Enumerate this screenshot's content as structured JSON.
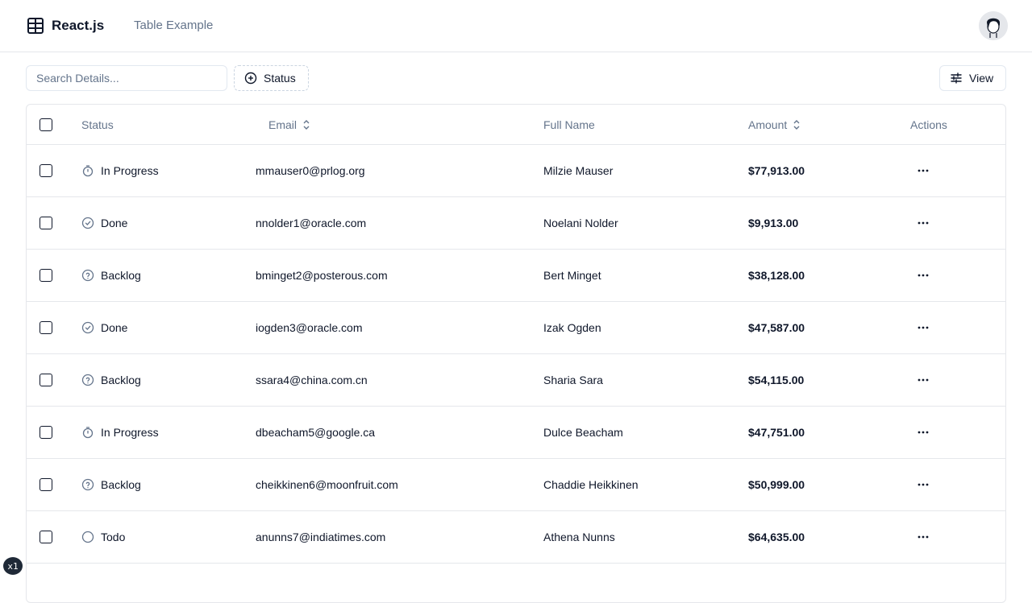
{
  "header": {
    "brand": "React.js",
    "brand_icon": "table-icon",
    "nav_link": "Table Example",
    "avatar_icon": "user-avatar"
  },
  "toolbar": {
    "search_placeholder": "Search Details...",
    "status_filter_label": "Status",
    "view_label": "View"
  },
  "table": {
    "columns": {
      "status": "Status",
      "email": "Email",
      "full_name": "Full Name",
      "amount": "Amount",
      "actions": "Actions"
    },
    "rows": [
      {
        "status": "In Progress",
        "status_icon": "timer-icon",
        "email": "mmauser0@prlog.org",
        "full_name": "Milzie Mauser",
        "amount": "$77,913.00"
      },
      {
        "status": "Done",
        "status_icon": "check-circle-icon",
        "email": "nnolder1@oracle.com",
        "full_name": "Noelani Nolder",
        "amount": "$9,913.00"
      },
      {
        "status": "Backlog",
        "status_icon": "help-circle-icon",
        "email": "bminget2@posterous.com",
        "full_name": "Bert Minget",
        "amount": "$38,128.00"
      },
      {
        "status": "Done",
        "status_icon": "check-circle-icon",
        "email": "iogden3@oracle.com",
        "full_name": "Izak Ogden",
        "amount": "$47,587.00"
      },
      {
        "status": "Backlog",
        "status_icon": "help-circle-icon",
        "email": "ssara4@china.com.cn",
        "full_name": "Sharia Sara",
        "amount": "$54,115.00"
      },
      {
        "status": "In Progress",
        "status_icon": "timer-icon",
        "email": "dbeacham5@google.ca",
        "full_name": "Dulce Beacham",
        "amount": "$47,751.00"
      },
      {
        "status": "Backlog",
        "status_icon": "help-circle-icon",
        "email": "cheikkinen6@moonfruit.com",
        "full_name": "Chaddie Heikkinen",
        "amount": "$50,999.00"
      },
      {
        "status": "Todo",
        "status_icon": "circle-icon",
        "email": "anunns7@indiatimes.com",
        "full_name": "Athena Nunns",
        "amount": "$64,635.00"
      }
    ]
  },
  "badge": "x1"
}
